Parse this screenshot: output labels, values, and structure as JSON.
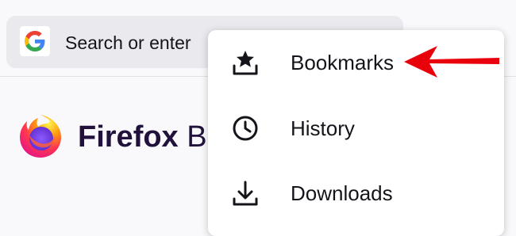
{
  "urlbar": {
    "search_engine_icon": "google-g-icon",
    "text": "Search or enter"
  },
  "homepage": {
    "logo_icon": "firefox-logo",
    "brand_bold": "Firefox",
    "brand_rest": "B"
  },
  "menu": {
    "items": [
      {
        "label": "Bookmarks",
        "icon": "bookmarks-star-tray-icon"
      },
      {
        "label": "History",
        "icon": "clock-icon"
      },
      {
        "label": "Downloads",
        "icon": "download-arrow-icon"
      }
    ]
  },
  "annotation": {
    "arrow_color": "#e8000a",
    "points_to": "Bookmarks"
  },
  "colors": {
    "urlbar_bg": "#e9e9ee",
    "menu_bg": "#ffffff",
    "text": "#15141a",
    "brand_text": "#20123a",
    "accent_purple": "#2b2a33"
  }
}
